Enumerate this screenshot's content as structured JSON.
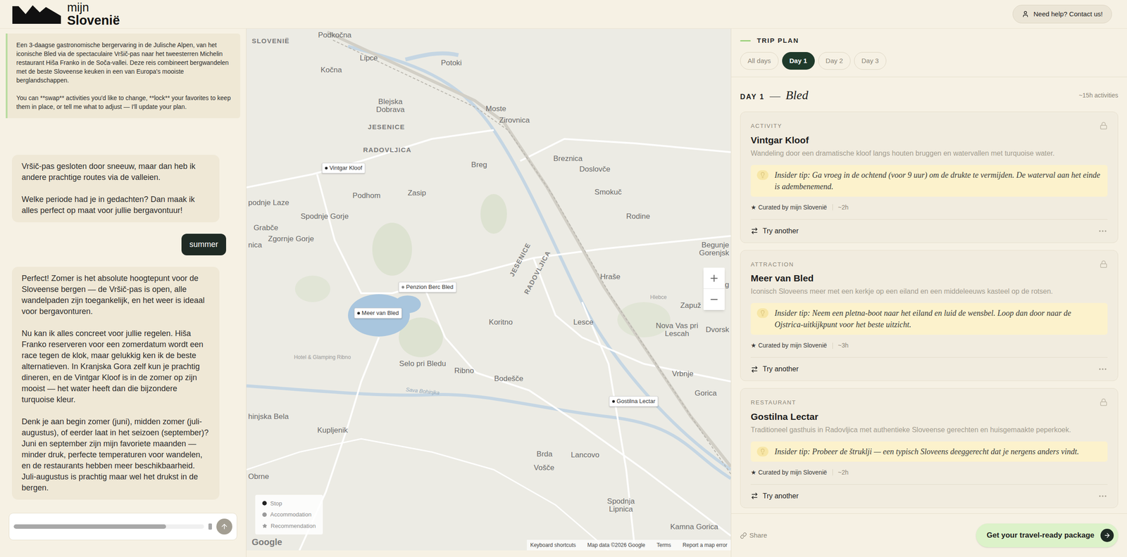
{
  "header": {
    "logo": {
      "line1": "mijn",
      "line2": "Slovenië"
    },
    "help": "Need help? Contact us!"
  },
  "intro": {
    "paragraphs": [
      "Een 3-daagse gastronomische bergervaring in de Julische Alpen, van het iconische Bled via de spectaculaire Vršič-pas naar het tweesterren Michelin restaurant Hiša Franko in de Soča-vallei. Deze reis combineert bergwandelen met de beste Sloveense keuken in een van Europa's mooiste berglandschappen.",
      "You can **swap** activities you'd like to change, **lock** your favorites to keep them in place, or tell me what to adjust — I'll update your plan."
    ]
  },
  "chat": {
    "messages": [
      {
        "role": "assistant",
        "paragraphs": [
          "Vršič-pas gesloten door sneeuw, maar dan heb ik andere prachtige routes via de valleien.",
          "Welke periode had je in gedachten? Dan maak ik alles perfect op maat voor jullie bergavontuur!"
        ]
      },
      {
        "role": "user",
        "paragraphs": [
          "summer"
        ]
      },
      {
        "role": "assistant",
        "paragraphs": [
          "Perfect! Zomer is het absolute hoogtepunt voor de Sloveense bergen — de Vršič-pas is open, alle wandelpaden zijn toegankelijk, en het weer is ideaal voor bergavonturen.",
          "Nu kan ik alles concreet voor jullie regelen. Hiša Franko reserveren voor een zomerdatum wordt een race tegen de klok, maar gelukkig ken ik de beste alternatieven. In Kranjska Gora zelf kun je prachtig dineren, en de Vintgar Kloof is in de zomer op zijn mooist — het water heeft dan die bijzondere turquoise kleur.",
          "Denk je aan begin zomer (juni), midden zomer (juli-augustus), of eerder laat in het seizoen (september)? Juni en september zijn mijn favoriete maanden — minder druk, perfecte temperaturen voor wandelen, en de restaurants hebben meer beschikbaarheid. Juli-augustus is prachtig maar wel het drukst in de bergen."
        ]
      }
    ],
    "input": {
      "scrollbar_level": 0.8,
      "send_disabled": true
    }
  },
  "map": {
    "labels": [
      {
        "text": "SLOVENIË",
        "kind": "region"
      },
      {
        "text": "Podkočna",
        "kind": "place"
      },
      {
        "text": "Lipce",
        "kind": "place"
      },
      {
        "text": "Potoki",
        "kind": "place"
      },
      {
        "text": "Kočna",
        "kind": "place"
      },
      {
        "text": "Moste",
        "kind": "place"
      },
      {
        "text": "Zirovnica",
        "kind": "place"
      },
      {
        "text": "Blejska Dobrava",
        "kind": "place"
      },
      {
        "text": "JESENICE",
        "kind": "region"
      },
      {
        "text": "RADOVLJICA",
        "kind": "region"
      },
      {
        "text": "Breg",
        "kind": "place"
      },
      {
        "text": "Breznica",
        "kind": "place"
      },
      {
        "text": "Doslovče",
        "kind": "place"
      },
      {
        "text": "Smokuč",
        "kind": "place"
      },
      {
        "text": "Zasip",
        "kind": "place"
      },
      {
        "text": "Podhom",
        "kind": "place"
      },
      {
        "text": "Spodnje Gorje",
        "kind": "place"
      },
      {
        "text": "Rodine",
        "kind": "place"
      },
      {
        "text": "podnje Laze",
        "kind": "place"
      },
      {
        "text": "Grabče",
        "kind": "place"
      },
      {
        "text": "Zgornje Gorje",
        "kind": "place"
      },
      {
        "text": "nica",
        "kind": "place"
      },
      {
        "text": "Begunje Gorenjsk",
        "kind": "place"
      },
      {
        "text": "JESENICE",
        "kind": "rotated"
      },
      {
        "text": "RADOVLJICA",
        "kind": "rotated"
      },
      {
        "text": "Hraše",
        "kind": "place"
      },
      {
        "text": "Zg",
        "kind": "place"
      },
      {
        "text": "Zapuž",
        "kind": "place"
      },
      {
        "text": "Nova Vas pri Lescah",
        "kind": "place"
      },
      {
        "text": "Dvorsk",
        "kind": "place"
      },
      {
        "text": "Koritno",
        "kind": "place"
      },
      {
        "text": "Lesce",
        "kind": "place"
      },
      {
        "text": "Hlebce",
        "kind": "small"
      },
      {
        "text": "Hotel & Glamping Ribno",
        "kind": "small"
      },
      {
        "text": "Selo pri Bledu",
        "kind": "place"
      },
      {
        "text": "Ribno",
        "kind": "place"
      },
      {
        "text": "Bodešče",
        "kind": "place"
      },
      {
        "text": "Vrbnje",
        "kind": "place"
      },
      {
        "text": "Gorica",
        "kind": "place"
      },
      {
        "text": "Sava Bohinjka",
        "kind": "river"
      },
      {
        "text": "hinjska Bela",
        "kind": "place"
      },
      {
        "text": "Kupljenik",
        "kind": "place"
      },
      {
        "text": "Brda",
        "kind": "place"
      },
      {
        "text": "Lancovo",
        "kind": "place"
      },
      {
        "text": "Vošče",
        "kind": "place"
      },
      {
        "text": "Obrne",
        "kind": "place"
      },
      {
        "text": "Spodnja Lipnica",
        "kind": "place"
      },
      {
        "text": "Kamna Gorica",
        "kind": "place"
      }
    ],
    "pins": [
      {
        "label": "Vintgar Kloof",
        "kind": "stop"
      },
      {
        "label": "Penzion Berc Bled",
        "kind": "accommodation"
      },
      {
        "label": "Meer van Bled",
        "kind": "stop"
      },
      {
        "label": "Gostilna Lectar",
        "kind": "stop"
      }
    ],
    "legend": [
      {
        "label": "Stop",
        "kind": "stop"
      },
      {
        "label": "Accommodation",
        "kind": "accommodation"
      },
      {
        "label": "Recommendation",
        "kind": "recommendation"
      }
    ],
    "google": "Google",
    "attribution": [
      "Keyboard shortcuts",
      "Map data ©2026 Google",
      "Terms",
      "Report a map error"
    ]
  },
  "trip": {
    "title": "TRIP PLAN",
    "tabs": [
      {
        "label": "All days",
        "selected": false
      },
      {
        "label": "Day 1",
        "selected": true
      },
      {
        "label": "Day 2",
        "selected": false
      },
      {
        "label": "Day 3",
        "selected": false
      }
    ],
    "day": {
      "label": "DAY 1",
      "dash": "—",
      "name": "Bled",
      "duration": "~15h activities"
    },
    "cards": [
      {
        "category": "ACTIVITY",
        "title": "Vintgar Kloof",
        "description": "Wandeling door een dramatische kloof langs houten bruggen en watervallen met turquoise water.",
        "tip": "Insider tip: Ga vroeg in de ochtend (voor 9 uur) om de drukte te vermijden. De waterval aan het einde is adembenemend.",
        "star": "★",
        "curated": "Curated by mijn Slovenië",
        "duration": "~2h",
        "action": "Try another",
        "locked": false
      },
      {
        "category": "ATTRACTION",
        "title": "Meer van Bled",
        "description": "Iconisch Sloveens meer met een kerkje op een eiland en een middeleeuws kasteel op de rotsen.",
        "tip": "Insider tip: Neem een pletna-boot naar het eiland en luid de wensbel. Loop dan door naar de Ojstrica-uitkijkpunt voor het beste uitzicht.",
        "star": "★",
        "curated": "Curated by mijn Slovenië",
        "duration": "~3h",
        "action": "Try another",
        "locked": false
      },
      {
        "category": "RESTAURANT",
        "title": "Gostilna Lectar",
        "description": "Traditioneel gasthuis in Radovljica met authentieke Sloveense gerechten en huisgemaakte peperkoek.",
        "tip": "Insider tip: Probeer de štruklji — een typisch Sloveens deeggerecht dat je nergens anders vindt.",
        "star": "★",
        "curated": "Curated by mijn Slovenië",
        "duration": "~2h",
        "action": "Try another",
        "locked": false
      }
    ],
    "share": "Share",
    "cta": "Get your travel-ready package"
  }
}
